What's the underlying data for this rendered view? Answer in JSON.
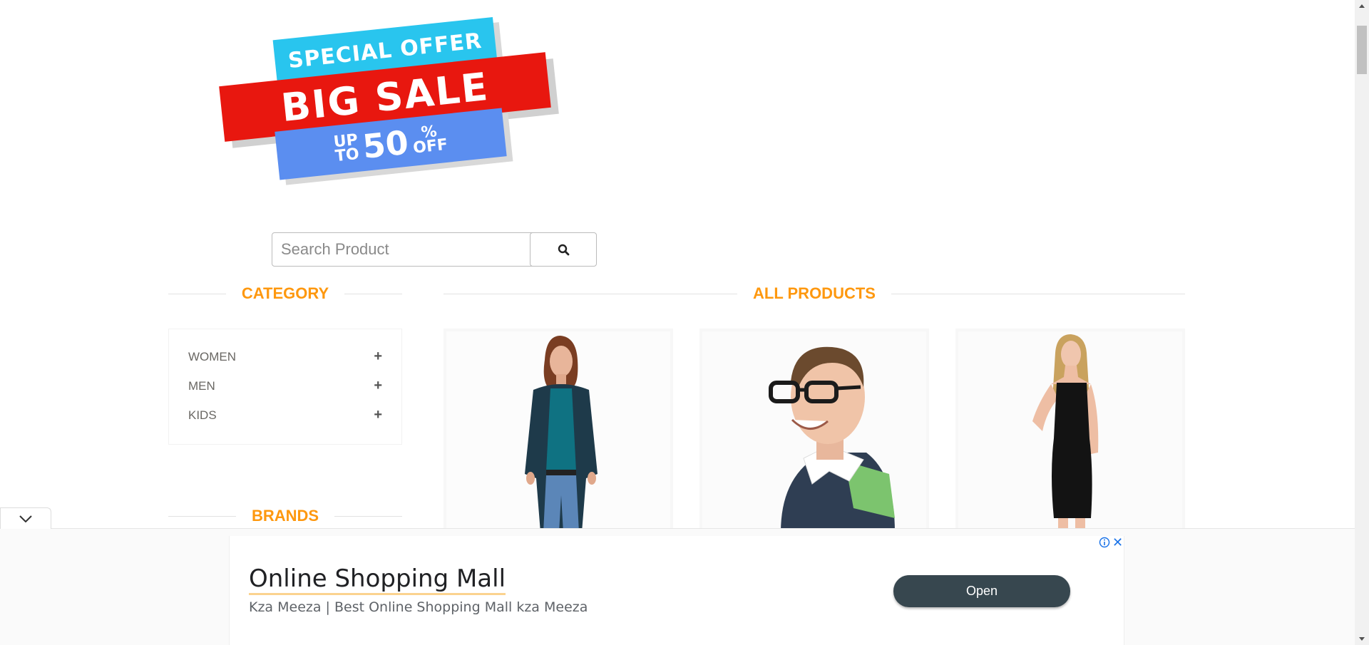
{
  "banner": {
    "line1": "SPECIAL OFFER",
    "line2": "BIG SALE",
    "up": "UP",
    "to": "TO",
    "percent_value": "50",
    "percent_sign": "%",
    "off": "OFF",
    "colors": {
      "cyan": "#29c5ee",
      "red": "#e8170f",
      "blue": "#5b8ef0"
    }
  },
  "search": {
    "placeholder": "Search Product",
    "value": "",
    "button_icon": "search-icon"
  },
  "sidebar": {
    "category_title": "CATEGORY",
    "categories": [
      {
        "label": "WOMEN",
        "icon": "plus-icon"
      },
      {
        "label": "MEN",
        "icon": "plus-icon"
      },
      {
        "label": "KIDS",
        "icon": "plus-icon"
      }
    ],
    "brands_title": "BRANDS"
  },
  "main": {
    "products_title": "ALL PRODUCTS",
    "products": [
      {
        "image": "woman-teal-top-cardigan-jeans"
      },
      {
        "image": "smiling-man-glasses-polo"
      },
      {
        "image": "woman-black-dress"
      }
    ]
  },
  "ad": {
    "title": "Online Shopping Mall",
    "description": "Kza Meeza | Best Online Shopping Mall kza Meeza",
    "open_label": "Open",
    "info_icon": "info-icon",
    "close_icon": "close-icon",
    "close_glyph": "✕"
  },
  "accent_color": "#fe980f"
}
